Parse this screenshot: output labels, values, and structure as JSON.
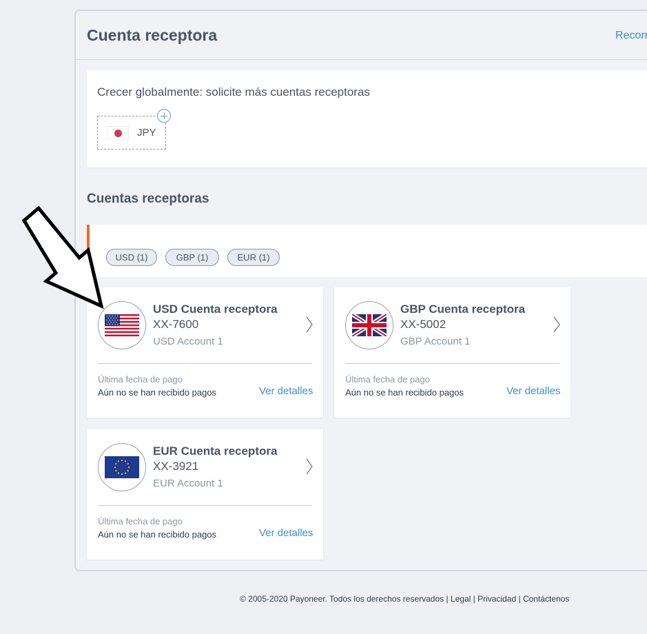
{
  "panel": {
    "title": "Cuenta receptora",
    "link": "Recorri"
  },
  "grow": {
    "text": "Crecer globalmente: solicite más cuentas receptoras",
    "chip_label": "JPY"
  },
  "section": {
    "title": "Cuentas receptoras"
  },
  "filters": [
    {
      "label": "USD (1)"
    },
    {
      "label": "GBP (1)"
    },
    {
      "label": "EUR (1)"
    }
  ],
  "accounts": [
    {
      "title": "USD Cuenta receptora",
      "number": "XX-7600",
      "name": "USD Account 1",
      "date_label": "Última fecha de pago",
      "date_value": "Aún no se han recibido pagos",
      "link": "Ver detalles",
      "flag_icon": "us-flag-icon"
    },
    {
      "title": "GBP Cuenta receptora",
      "number": "XX-5002",
      "name": "GBP Account 1",
      "date_label": "Última fecha de pago",
      "date_value": "Aún no se han recibido pagos",
      "link": "Ver detalles",
      "flag_icon": "uk-flag-icon"
    },
    {
      "title": "EUR Cuenta receptora",
      "number": "XX-3921",
      "name": "EUR Account 1",
      "date_label": "Última fecha de pago",
      "date_value": "Aún no se han recibido pagos",
      "link": "Ver detalles",
      "flag_icon": "eu-flag-icon"
    }
  ],
  "footer": {
    "copyright": "© 2005-2020 Payoneer. Todos los derechos reservados",
    "legal": "Legal",
    "privacy": "Privacidad",
    "contact": "Contáctenos"
  },
  "colors": {
    "accent": "#3e8fd0",
    "filter_accent": "#f36a1e",
    "background": "#eef0f4"
  }
}
